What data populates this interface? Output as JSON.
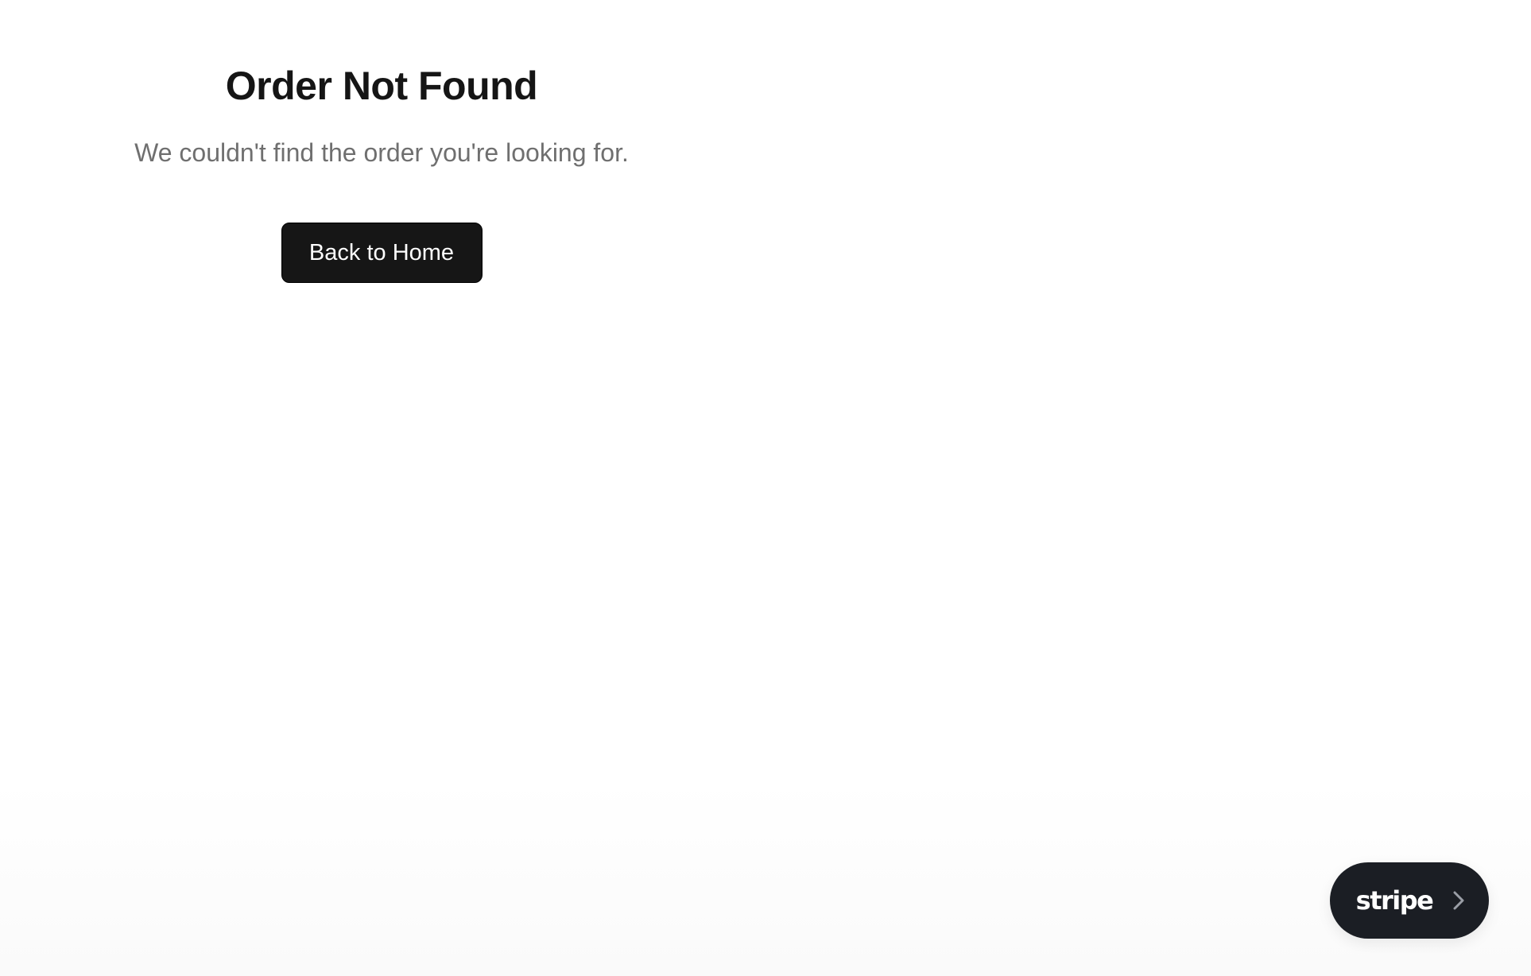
{
  "main": {
    "title": "Order Not Found",
    "message": "We couldn't find the order you're looking for.",
    "home_button_label": "Back to Home"
  },
  "badge": {
    "logo_text": "stripe",
    "icon": "chevron-right-icon"
  },
  "colors": {
    "button_bg": "#161616",
    "badge_bg": "#1b1e24",
    "title": "#151515",
    "message": "#6f6f6f"
  }
}
